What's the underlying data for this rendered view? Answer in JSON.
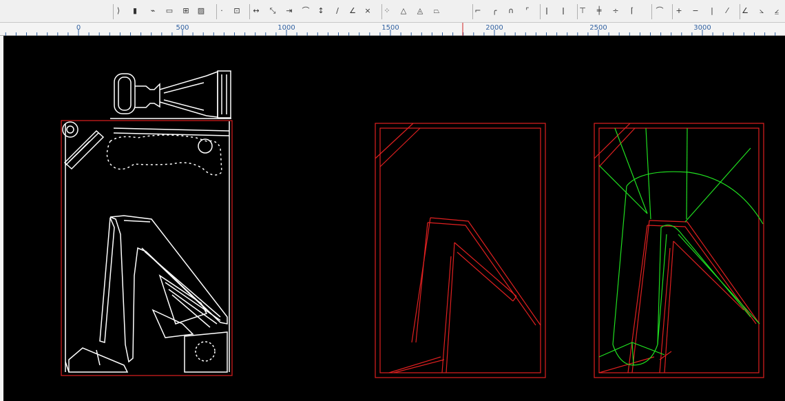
{
  "toolbar": {
    "buttons": [
      {
        "name": "contour-tool-icon",
        "glyph": "⟩"
      },
      {
        "name": "color-bars-icon",
        "glyph": "▮"
      },
      {
        "name": "point-chain-icon",
        "glyph": "⌁"
      },
      {
        "name": "rect-query-icon",
        "glyph": "▭"
      },
      {
        "name": "grid-select-icon",
        "glyph": "⊞"
      },
      {
        "name": "hatch-icon",
        "glyph": "▨"
      },
      {
        "name": "point-query-icon",
        "glyph": "·"
      },
      {
        "name": "text-tool-icon",
        "glyph": "⊡"
      },
      {
        "name": "distance-measure-icon",
        "glyph": "↔"
      },
      {
        "name": "diagonal-measure-icon",
        "glyph": "⤡"
      },
      {
        "name": "horizontal-measure-icon",
        "glyph": "⇥"
      },
      {
        "name": "arc-measure-icon",
        "glyph": "⌒"
      },
      {
        "name": "vertical-measure-icon",
        "glyph": "↕"
      },
      {
        "name": "slope-measure-icon",
        "glyph": "∕"
      },
      {
        "name": "angle-measure-icon",
        "glyph": "∠"
      },
      {
        "name": "multiply-measure-icon",
        "glyph": "×"
      },
      {
        "name": "points-query-icon",
        "glyph": "⁘"
      },
      {
        "name": "triangle-query-icon",
        "glyph": "△"
      },
      {
        "name": "area-query-icon",
        "glyph": "◬"
      },
      {
        "name": "polygon-query-icon",
        "glyph": "⏢"
      },
      {
        "name": "corner-left-icon",
        "glyph": "⌐"
      },
      {
        "name": "fillet-icon",
        "glyph": "╭"
      },
      {
        "name": "arch-icon",
        "glyph": "∩"
      },
      {
        "name": "chamfer-icon",
        "glyph": "⌜"
      },
      {
        "name": "break-point-icon",
        "glyph": "ǀ"
      },
      {
        "name": "break-mid-icon",
        "glyph": "ǀ"
      },
      {
        "name": "trim-top-icon",
        "glyph": "⊤"
      },
      {
        "name": "cross-icon",
        "glyph": "╪"
      },
      {
        "name": "divide-icon",
        "glyph": "÷"
      },
      {
        "name": "corner-drop-icon",
        "glyph": "⌈"
      },
      {
        "name": "arc-draw-icon",
        "glyph": "⌒"
      },
      {
        "name": "plus-icon",
        "glyph": "+"
      },
      {
        "name": "minus-icon",
        "glyph": "−"
      },
      {
        "name": "vertical-line-icon",
        "glyph": "|"
      },
      {
        "name": "percent-icon",
        "glyph": "⁄"
      },
      {
        "name": "line-angle-icon",
        "glyph": "∠"
      },
      {
        "name": "angle-draw-icon",
        "glyph": "⦣"
      },
      {
        "name": "angle-box-icon",
        "glyph": "⦤"
      }
    ]
  },
  "ruler": {
    "labels": [
      "0",
      "500",
      "1000",
      "1500",
      "2000",
      "2500",
      "3000"
    ]
  }
}
